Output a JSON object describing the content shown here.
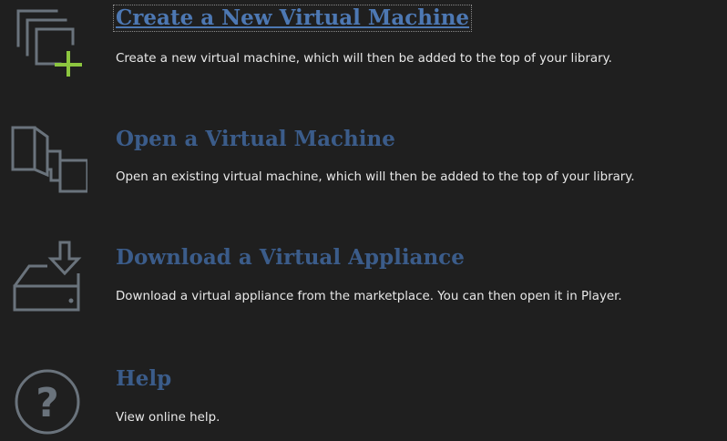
{
  "colors": {
    "background": "#1f1f1f",
    "link": "#3b5c8a",
    "link_focused": "#4d78b3",
    "text": "#e8e8e8",
    "icon": "#6a737c",
    "accent_green": "#8cc63f"
  },
  "actions": [
    {
      "title": "Create a New Virtual Machine",
      "description": "Create a new virtual machine, which will then be added to the top of your library.",
      "icon": "new-vm-plus-icon"
    },
    {
      "title": "Open a Virtual Machine",
      "description": "Open an existing virtual machine, which will then be added to the top of your library.",
      "icon": "open-vm-icon"
    },
    {
      "title": "Download a Virtual Appliance",
      "description": "Download a virtual appliance from the marketplace. You can then open it in Player.",
      "icon": "download-appliance-icon"
    },
    {
      "title": "Help",
      "description": "View online help.",
      "icon": "help-question-icon"
    }
  ]
}
